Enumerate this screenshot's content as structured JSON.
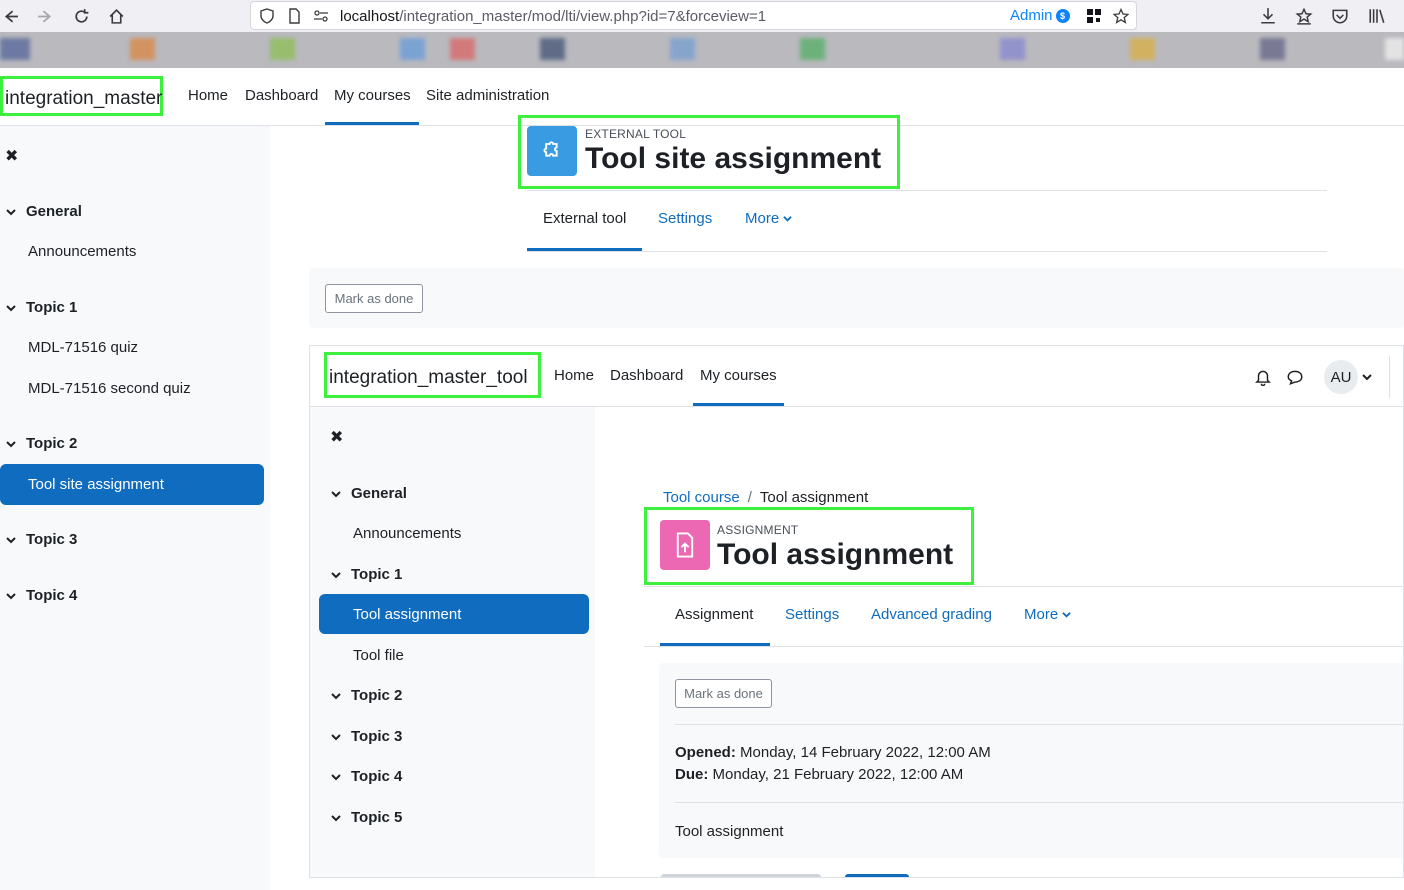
{
  "browser": {
    "url_host": "localhost",
    "url_path": "/integration_master/mod/lti/view.php?id=7&forceview=1",
    "account_label": "Admin",
    "account_badge": "$"
  },
  "outer": {
    "brand": "integration_master",
    "nav": [
      "Home",
      "Dashboard",
      "My courses",
      "Site administration"
    ],
    "active_nav_index": 2,
    "drawer": {
      "close_glyph": "✖",
      "sections": [
        {
          "title": "General",
          "items": [
            "Announcements"
          ]
        },
        {
          "title": "Topic 1",
          "items": [
            "MDL-71516 quiz",
            "MDL-71516 second quiz"
          ]
        },
        {
          "title": "Topic 2",
          "items": [
            "Tool site assignment"
          ]
        },
        {
          "title": "Topic 3",
          "items": []
        },
        {
          "title": "Topic 4",
          "items": []
        }
      ],
      "active_item": "Tool site assignment"
    },
    "header": {
      "module_label": "EXTERNAL TOOL",
      "title": "Tool site assignment",
      "icon": "puzzle-icon",
      "icon_color": "#399be2"
    },
    "tabs": [
      "External tool",
      "Settings",
      "More"
    ],
    "active_tab_index": 0,
    "mark_done": "Mark as done"
  },
  "inner": {
    "brand": "integration_master_tool",
    "nav": [
      "Home",
      "Dashboard",
      "My courses"
    ],
    "active_nav_index": 2,
    "user_initials": "AU",
    "drawer": {
      "close_glyph": "✖",
      "sections": [
        {
          "title": "General",
          "items": [
            "Announcements"
          ]
        },
        {
          "title": "Topic 1",
          "items": [
            "Tool assignment",
            "Tool file"
          ]
        },
        {
          "title": "Topic 2",
          "items": []
        },
        {
          "title": "Topic 3",
          "items": []
        },
        {
          "title": "Topic 4",
          "items": []
        },
        {
          "title": "Topic 5",
          "items": []
        }
      ],
      "active_item": "Tool assignment"
    },
    "breadcrumb": [
      "Tool course",
      "Tool assignment"
    ],
    "header": {
      "module_label": "ASSIGNMENT",
      "title": "Tool assignment",
      "icon": "assignment-upload-icon",
      "icon_color": "#f7634d"
    },
    "tabs": [
      "Assignment",
      "Settings",
      "Advanced grading",
      "More"
    ],
    "active_tab_index": 0,
    "mark_done": "Mark as done",
    "opened_label": "Opened:",
    "opened_value": "Monday, 14 February 2022, 12:00 AM",
    "due_label": "Due:",
    "due_value": "Monday, 21 February 2022, 12:00 AM",
    "description": "Tool assignment"
  },
  "colors": {
    "primary": "#0f6cbf",
    "highlight_box": "#3ef03e",
    "drawer_bg": "#f8f9fa"
  }
}
